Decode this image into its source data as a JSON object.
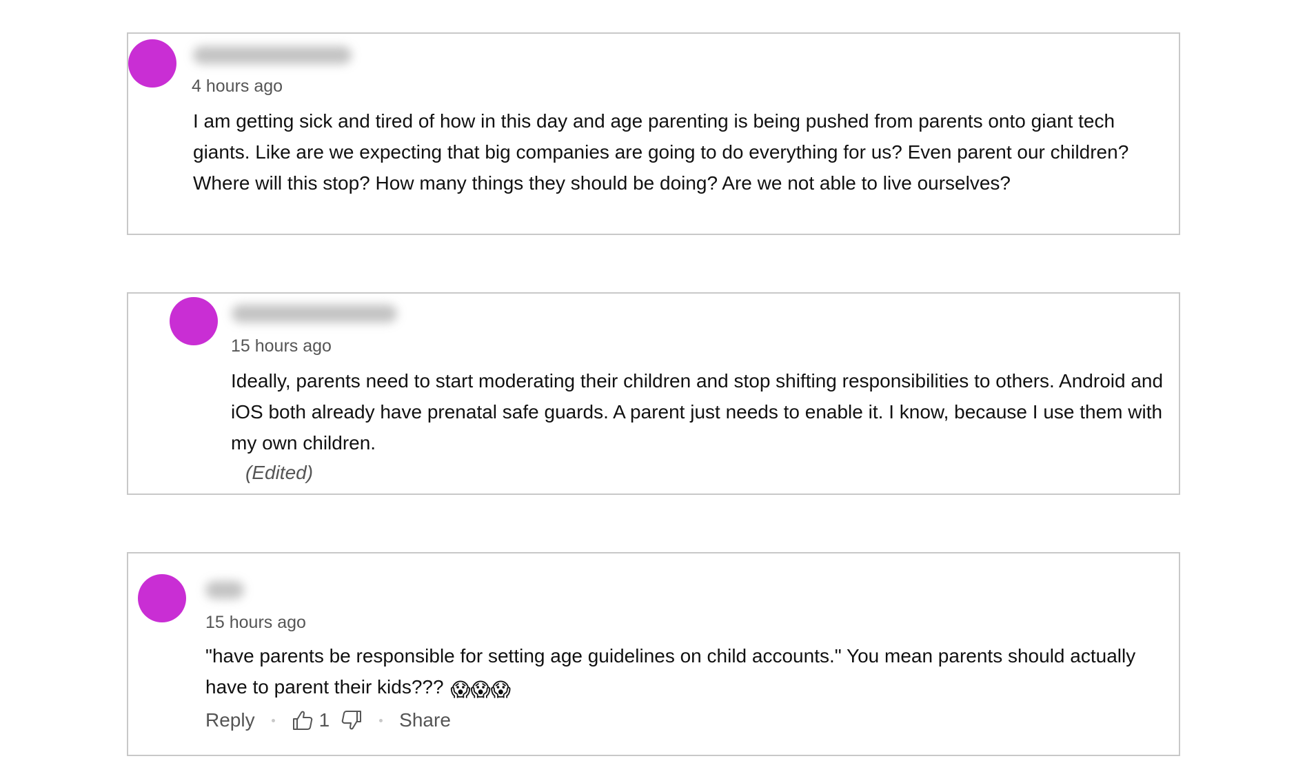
{
  "comments": [
    {
      "time": "4 hours ago",
      "text": "I am getting sick and tired of how in this day and age parenting is being pushed from parents onto giant tech giants. Like are we expecting that big companies are going to do everything for us? Even parent our children? Where will this stop? How many things they should be doing? Are we not able to live ourselves?"
    },
    {
      "time": "15 hours ago",
      "text": "Ideally, parents need to start moderating their children and stop shifting responsibilities to others. Android and iOS both already have prenatal safe guards. A parent just needs to enable it. I know, because I use them with my own children.",
      "edited": "(Edited)"
    },
    {
      "time": "15 hours ago",
      "text": "\"have parents be responsible for setting age guidelines on child accounts.\" You mean parents should actually have to parent their kids???",
      "emoji": "😱😱😱",
      "actions": {
        "reply": "Reply",
        "likes": "1",
        "share": "Share"
      }
    }
  ],
  "colors": {
    "avatar": "#c92ed4",
    "border": "#c8c8c8",
    "text": "#111111",
    "muted": "#555555"
  },
  "icons": [
    "thumbs-up-icon",
    "thumbs-down-icon",
    "scream-emoji"
  ]
}
